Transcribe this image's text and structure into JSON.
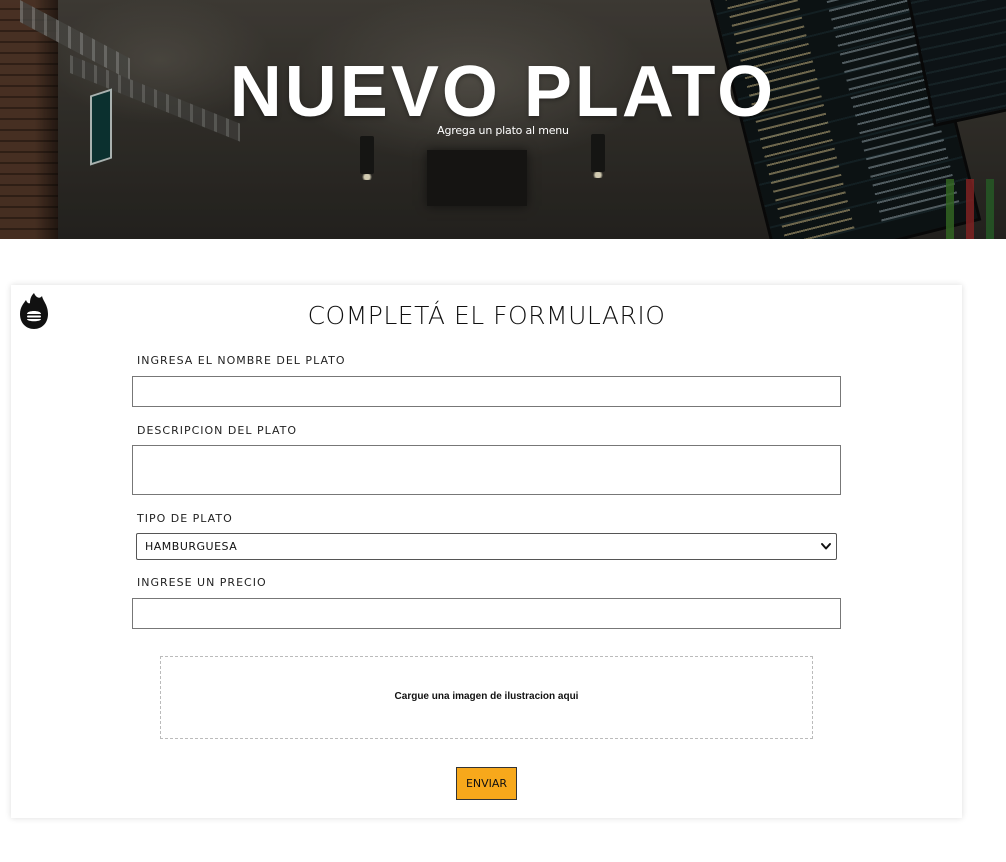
{
  "hero": {
    "title": "NUEVO PLATO",
    "subtitle": "Agrega un plato al menu"
  },
  "form": {
    "title": "COMPLETÁ EL FORMULARIO",
    "logo_icon": "flame-burger-icon",
    "fields": {
      "name_label": "INGRESA EL NOMBRE DEL PLATO",
      "name_value": "",
      "description_label": "DESCRIPCION DEL PLATO",
      "description_value": "",
      "type_label": "TIPO DE PLATO",
      "type_selected": "HAMBURGUESA",
      "type_chevron_icon": "chevron-down-icon",
      "price_label": "INGRESE UN PRECIO",
      "price_value": ""
    },
    "dropzone_text": "Cargue una imagen de ilustracion aqui",
    "submit_label": "ENVIAR"
  },
  "colors": {
    "accent": "#f7a81b",
    "text": "#111111",
    "border": "#777777"
  }
}
